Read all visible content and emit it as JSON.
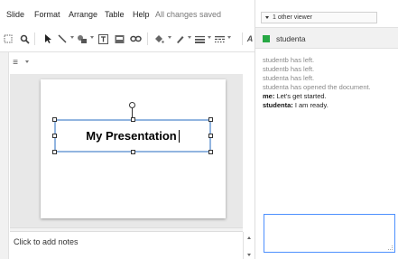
{
  "menubar": {
    "items": [
      "Slide",
      "Format",
      "Arrange",
      "Table",
      "Help"
    ],
    "save_status": "All changes saved"
  },
  "toolbar": {
    "icons": [
      "zoom-icon",
      "magnifier-icon",
      "select-arrow-icon",
      "line-icon",
      "shape-icon",
      "textbox-icon",
      "image-icon",
      "link-icon",
      "fill-color-icon",
      "line-color-icon",
      "line-weight-icon",
      "line-dash-icon"
    ],
    "overflow_icon": "text-a-icon",
    "menu_glyph": "≡"
  },
  "slide": {
    "title_text": "My Presentation"
  },
  "notes": {
    "placeholder": "Click to add notes"
  },
  "chat": {
    "viewer_count": "1 other viewer",
    "header_user": "studenta",
    "user_color": "#27a844",
    "messages": [
      {
        "type": "system",
        "text": "studentb has left."
      },
      {
        "type": "system",
        "text": "studentb has left."
      },
      {
        "type": "system",
        "text": "studenta has left."
      },
      {
        "type": "system",
        "text": "studenta has opened the document."
      },
      {
        "type": "chat",
        "sender": "me:",
        "text": "Let's get started."
      },
      {
        "type": "chat",
        "sender": "studenta:",
        "text": "I am ready."
      }
    ],
    "input_value": ""
  }
}
